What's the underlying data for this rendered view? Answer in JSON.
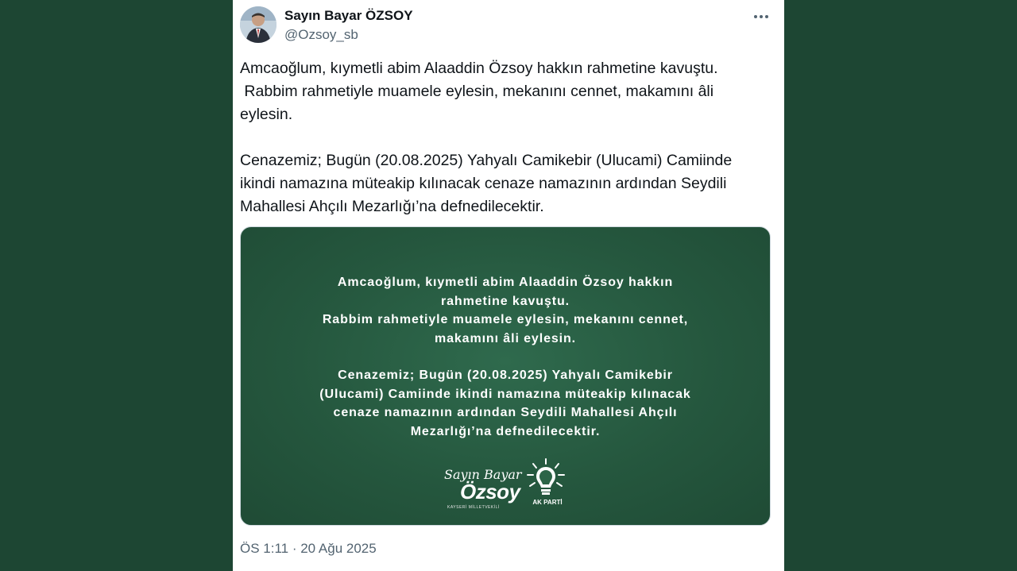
{
  "user": {
    "name": "Sayın Bayar ÖZSOY",
    "handle": "@Ozsoy_sb"
  },
  "tweet": {
    "text": "Amcaoğlum, kıymetli abim Alaaddin Özsoy hakkın rahmetine kavuştu.\n Rabbim rahmetiyle muamele eylesin, mekanını cennet, makamını âli\neylesin.\n\nCenazemiz; Bugün (20.08.2025) Yahyalı Camikebir (Ulucami) Camiinde\nikindi namazına müteakip kılınacak cenaze namazının ardından Seydili\nMahallesi Ahçılı Mezarlığı’na defnedilecektir.",
    "timestamp": "ÖS 1:11 · 20 Ağu 2025"
  },
  "media": {
    "paragraph1": "Amcaoğlum, kıymetli abim Alaaddin Özsoy hakkın\nrahmetine kavuştu.\nRabbim rahmetiyle muamele eylesin, mekanını cennet,\nmakamını âli eylesin.",
    "paragraph2": "Cenazemiz; Bugün (20.08.2025) Yahyalı Camikebir\n(Ulucami) Camiinde ikindi namazına müteakip kılınacak\ncenaze namazının ardından Seydili Mahallesi Ahçılı\nMezarlığı’na defnedilecektir.",
    "signature_top": "Sayın Bayar",
    "signature_main": "Özsoy",
    "signature_sub": "KAYSERİ MİLLETVEKİLİ",
    "party_name": "AK PARTİ",
    "background_color": "#25573e"
  },
  "icons": {
    "more": "more-horizontal-icon",
    "avatar": "user-avatar",
    "party": "lightbulb-logo"
  },
  "colors": {
    "page_background": "#1f4a36",
    "text_primary": "#0f1419",
    "text_secondary": "#536471"
  }
}
